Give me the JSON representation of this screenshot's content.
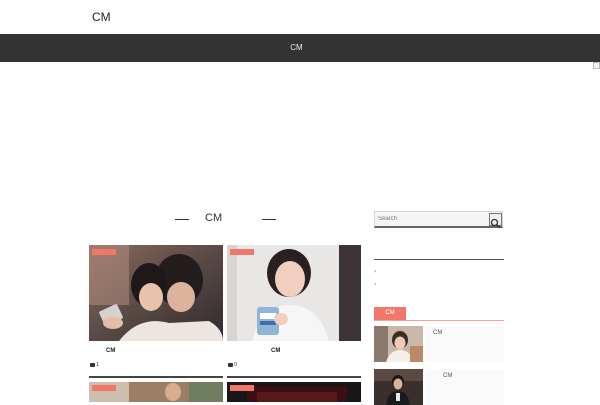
{
  "header": {
    "site_title": "CM"
  },
  "nav": {
    "item_label": "CM"
  },
  "main": {
    "heading": "CM"
  },
  "cards": [
    {
      "title": "CM",
      "comment_count": "1"
    },
    {
      "title": "CM",
      "comment_count": "0"
    }
  ],
  "sidebar": {
    "search_placeholder": "Search",
    "arrow_1": "›",
    "arrow_2": "›",
    "tab_label": "CM",
    "items": [
      {
        "title": "CM"
      },
      {
        "title": "CM"
      }
    ]
  },
  "colors": {
    "nav_bg": "#333333",
    "accent": "#f2776b"
  },
  "icons": {
    "search": "search-icon",
    "comment": "comment-icon"
  }
}
